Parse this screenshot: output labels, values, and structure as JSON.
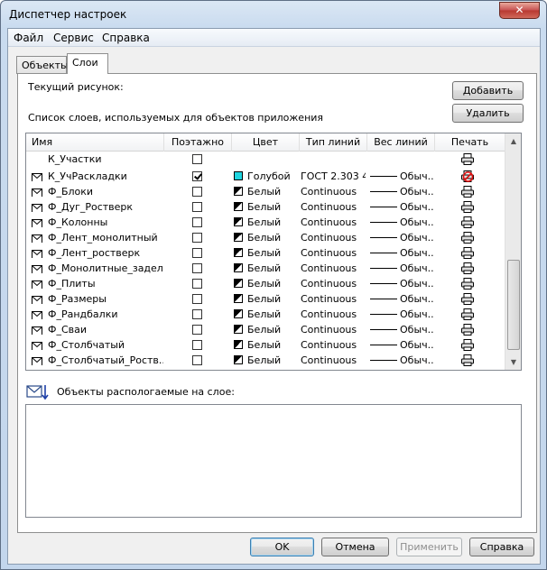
{
  "window": {
    "title": "Диспетчер настроек",
    "close_glyph": "✕"
  },
  "menu": [
    "Файл",
    "Сервис",
    "Справка"
  ],
  "tabs": [
    "Объекты",
    "Слои"
  ],
  "panel": {
    "current_drawing_label": "Текущий рисунок:",
    "layers_list_label": "Список слоев, используемых для объектов приложения",
    "add_button": "Добавить",
    "delete_button": "Удалить",
    "objects_on_layer_label": "Объекты распологаемые на слое:"
  },
  "table": {
    "columns": [
      "Имя",
      "Поэтажно",
      "Цвет",
      "Тип линий",
      "Вес линий",
      "Печать"
    ],
    "rows": [
      {
        "name": "К_Участки",
        "floor": false,
        "color": "",
        "linetype": "",
        "weight": "",
        "print": "printer-icon",
        "envelope": false,
        "partial": true
      },
      {
        "name": "К_УчРаскладки",
        "floor": true,
        "color": "Голубой",
        "color_hex": "#1fd5e0",
        "linetype": "ГОСТ 2.303 4",
        "weight": "Обыч...",
        "print": "printer-no-icon",
        "envelope": true
      },
      {
        "name": "Ф_Блоки",
        "floor": false,
        "color": "Белый",
        "linetype": "Continuous",
        "weight": "Обыч...",
        "print": "printer-icon",
        "envelope": true
      },
      {
        "name": "Ф_Дуг_Ростверк",
        "floor": false,
        "color": "Белый",
        "linetype": "Continuous",
        "weight": "Обыч...",
        "print": "printer-icon",
        "envelope": true
      },
      {
        "name": "Ф_Колонны",
        "floor": false,
        "color": "Белый",
        "linetype": "Continuous",
        "weight": "Обыч...",
        "print": "printer-icon",
        "envelope": true
      },
      {
        "name": "Ф_Лент_монолитный",
        "floor": false,
        "color": "Белый",
        "linetype": "Continuous",
        "weight": "Обыч...",
        "print": "printer-icon",
        "envelope": true
      },
      {
        "name": "Ф_Лент_ростверк",
        "floor": false,
        "color": "Белый",
        "linetype": "Continuous",
        "weight": "Обыч...",
        "print": "printer-icon",
        "envelope": true
      },
      {
        "name": "Ф_Монолитные_задел...",
        "floor": false,
        "color": "Белый",
        "linetype": "Continuous",
        "weight": "Обыч...",
        "print": "printer-icon",
        "envelope": true
      },
      {
        "name": "Ф_Плиты",
        "floor": false,
        "color": "Белый",
        "linetype": "Continuous",
        "weight": "Обыч...",
        "print": "printer-icon",
        "envelope": true
      },
      {
        "name": "Ф_Размеры",
        "floor": false,
        "color": "Белый",
        "linetype": "Continuous",
        "weight": "Обыч...",
        "print": "printer-icon",
        "envelope": true
      },
      {
        "name": "Ф_Рандбалки",
        "floor": false,
        "color": "Белый",
        "linetype": "Continuous",
        "weight": "Обыч...",
        "print": "printer-icon",
        "envelope": true
      },
      {
        "name": "Ф_Сваи",
        "floor": false,
        "color": "Белый",
        "linetype": "Continuous",
        "weight": "Обыч...",
        "print": "printer-icon",
        "envelope": true
      },
      {
        "name": "Ф_Столбчатый",
        "floor": false,
        "color": "Белый",
        "linetype": "Continuous",
        "weight": "Обыч...",
        "print": "printer-icon",
        "envelope": true
      },
      {
        "name": "Ф_Столбчатый_Роств...",
        "floor": false,
        "color": "Белый",
        "linetype": "Continuous",
        "weight": "Обыч...",
        "print": "printer-icon",
        "envelope": true
      }
    ]
  },
  "footer": {
    "ok": "OK",
    "cancel": "Отмена",
    "apply": "Применить",
    "help": "Справка"
  }
}
